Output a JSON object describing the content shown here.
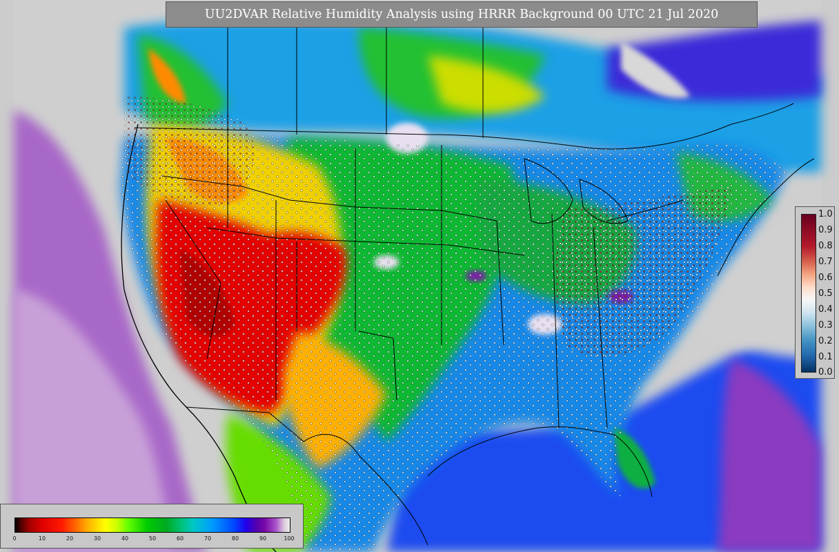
{
  "title": "UU2DVAR Relative Humidity Analysis using HRRR Background 00 UTC 21 Jul 2020",
  "legend_right": {
    "ticks": [
      "1.0",
      "0.9",
      "0.8",
      "0.7",
      "0.6",
      "0.5",
      "0.4",
      "0.3",
      "0.2",
      "0.1",
      "0.0"
    ]
  },
  "legend_bottom": {
    "ticks": [
      "0",
      "10",
      "20",
      "30",
      "40",
      "50",
      "60",
      "70",
      "80",
      "90",
      "100"
    ]
  },
  "colors": {
    "no_data": "#cccccc",
    "dry": "#e00000",
    "moderate": "#00c000",
    "humid": "#0066ff",
    "saturated": "#6a0aa6"
  }
}
